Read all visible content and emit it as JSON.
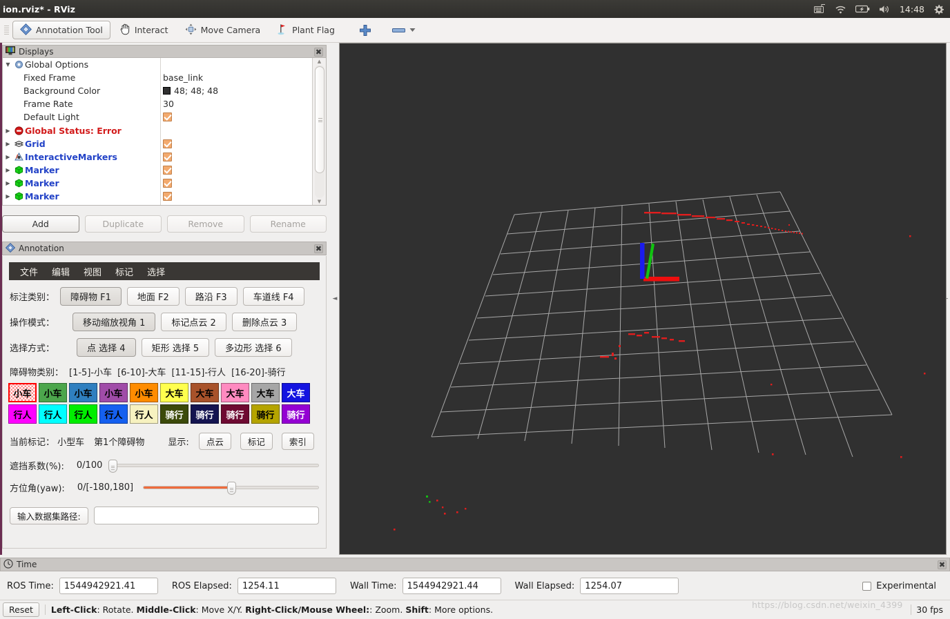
{
  "window": {
    "title": "ion.rviz* - RViz",
    "clock": "14:48",
    "tray_icons": [
      "keyboard-icon",
      "wifi-icon",
      "battery-icon",
      "volume-icon",
      "gear-icon"
    ]
  },
  "toolbar": {
    "items": [
      {
        "label": "Annotation Tool",
        "icon": "annotation-diamond-icon",
        "active": true
      },
      {
        "label": "Interact",
        "icon": "hand-cursor-icon",
        "active": false
      },
      {
        "label": "Move Camera",
        "icon": "move-camera-icon",
        "active": false
      },
      {
        "label": "Plant Flag",
        "icon": "flag-icon",
        "active": false
      }
    ],
    "add_tool_label": "+",
    "dropdown_label": ""
  },
  "displays": {
    "title": "Displays",
    "close_label": "✖",
    "rows": [
      {
        "name": "Global Options",
        "indent": false,
        "arrow": "▼",
        "icon": "gear-icon",
        "style": "plain",
        "value": "",
        "checkbox": false
      },
      {
        "name": "Fixed Frame",
        "indent": true,
        "arrow": "",
        "icon": "",
        "style": "plain",
        "value": "base_link",
        "checkbox": false
      },
      {
        "name": "Background Color",
        "indent": true,
        "arrow": "",
        "icon": "",
        "style": "plain",
        "value": "48; 48; 48",
        "swatch": "#303030",
        "checkbox": false
      },
      {
        "name": "Frame Rate",
        "indent": true,
        "arrow": "",
        "icon": "",
        "style": "plain",
        "value": "30",
        "checkbox": false
      },
      {
        "name": "Default Light",
        "indent": true,
        "arrow": "",
        "icon": "",
        "style": "plain",
        "value": "",
        "checkbox": true
      },
      {
        "name": "Global Status: Error",
        "indent": false,
        "arrow": "▶",
        "icon": "error-icon",
        "style": "red",
        "value": "",
        "checkbox": false
      },
      {
        "name": "Grid",
        "indent": false,
        "arrow": "▶",
        "icon": "grid-icon",
        "style": "blue",
        "value": "",
        "checkbox": true
      },
      {
        "name": "InteractiveMarkers",
        "indent": false,
        "arrow": "▶",
        "icon": "interactive-markers-icon",
        "style": "blue",
        "value": "",
        "checkbox": true
      },
      {
        "name": "Marker",
        "indent": false,
        "arrow": "▶",
        "icon": "marker-cube-icon",
        "style": "blue",
        "value": "",
        "checkbox": true
      },
      {
        "name": "Marker",
        "indent": false,
        "arrow": "▶",
        "icon": "marker-cube-icon",
        "style": "blue",
        "value": "",
        "checkbox": true
      },
      {
        "name": "Marker",
        "indent": false,
        "arrow": "▶",
        "icon": "marker-cube-icon",
        "style": "blue",
        "value": "",
        "checkbox": true
      }
    ],
    "buttons": [
      {
        "label": "Add",
        "enabled": true
      },
      {
        "label": "Duplicate",
        "enabled": false
      },
      {
        "label": "Remove",
        "enabled": false
      },
      {
        "label": "Rename",
        "enabled": false
      }
    ]
  },
  "annotation": {
    "title": "Annotation",
    "close_label": "✖",
    "menu": [
      "文件",
      "编辑",
      "视图",
      "标记",
      "选择"
    ],
    "label_type": "标注类别：",
    "type_buttons": [
      {
        "label": "障碍物 F1",
        "selected": true
      },
      {
        "label": "地面 F2",
        "selected": false
      },
      {
        "label": "路沿 F3",
        "selected": false
      },
      {
        "label": "车道线 F4",
        "selected": false
      }
    ],
    "label_mode": "操作模式：",
    "mode_buttons": [
      {
        "label": "移动缩放视角 1",
        "selected": true
      },
      {
        "label": "标记点云 2",
        "selected": false
      },
      {
        "label": "删除点云 3",
        "selected": false
      }
    ],
    "label_select": "选择方式：",
    "select_buttons": [
      {
        "label": "点 选择 4",
        "selected": true
      },
      {
        "label": "矩形 选择 5",
        "selected": false
      },
      {
        "label": "多边形 选择 6",
        "selected": false
      }
    ],
    "obstacle_legend_label": "障碍物类别：",
    "obstacle_legend": [
      "[1-5]-小车",
      "[6-10]-大车",
      "[11-15]-行人",
      "[16-20]-骑行"
    ],
    "cat_row1": [
      {
        "label": "小车",
        "bg": "#ff3b30",
        "fg": "#000000",
        "selected": true
      },
      {
        "label": "小车",
        "bg": "#4ca64c",
        "fg": "#000000",
        "selected": false
      },
      {
        "label": "小车",
        "bg": "#2f7fbf",
        "fg": "#000000",
        "selected": false
      },
      {
        "label": "小车",
        "bg": "#a04ca8",
        "fg": "#000000",
        "selected": false
      },
      {
        "label": "小车",
        "bg": "#ff8c00",
        "fg": "#000000",
        "selected": false
      },
      {
        "label": "大车",
        "bg": "#ffff4d",
        "fg": "#000000",
        "selected": false
      },
      {
        "label": "大车",
        "bg": "#a8522a",
        "fg": "#000000",
        "selected": false
      },
      {
        "label": "大车",
        "bg": "#ff8ac0",
        "fg": "#000000",
        "selected": false
      },
      {
        "label": "大车",
        "bg": "#a6a6a6",
        "fg": "#000000",
        "selected": false
      },
      {
        "label": "大车",
        "bg": "#1414e0",
        "fg": "#ffffff",
        "selected": false
      }
    ],
    "cat_row2": [
      {
        "label": "行人",
        "bg": "#ff00ff",
        "fg": "#000000",
        "selected": false
      },
      {
        "label": "行人",
        "bg": "#00ffff",
        "fg": "#000000",
        "selected": false
      },
      {
        "label": "行人",
        "bg": "#00ee00",
        "fg": "#000000",
        "selected": false
      },
      {
        "label": "行人",
        "bg": "#1560f0",
        "fg": "#000000",
        "selected": false
      },
      {
        "label": "行人",
        "bg": "#f7f2c0",
        "fg": "#000000",
        "selected": false
      },
      {
        "label": "骑行",
        "bg": "#3c4a0a",
        "fg": "#ffffff",
        "selected": false
      },
      {
        "label": "骑行",
        "bg": "#141450",
        "fg": "#ffffff",
        "selected": false
      },
      {
        "label": "骑行",
        "bg": "#6e0a32",
        "fg": "#ffffff",
        "selected": false
      },
      {
        "label": "骑行",
        "bg": "#b5a400",
        "fg": "#000000",
        "selected": false
      },
      {
        "label": "骑行",
        "bg": "#9400d3",
        "fg": "#ffffff",
        "selected": false
      }
    ],
    "current_label": "当前标记： 小型车",
    "current_index": "第1个障碍物",
    "display_label": "显示:",
    "display_buttons": [
      "点云",
      "标记",
      "索引"
    ],
    "occlusion_label": "遮挡系数(%):",
    "occlusion_value": "0/100",
    "occlusion_percent": 0,
    "yaw_label": "方位角(yaw):",
    "yaw_value": "0/[-180,180]",
    "yaw_percent": 50,
    "path_button": "输入数据集路径:",
    "path_value": "",
    "path_placeholder": ""
  },
  "time": {
    "title": "Time",
    "close_label": "✖",
    "fields": [
      {
        "label": "ROS Time:",
        "value": "1544942921.41"
      },
      {
        "label": "ROS Elapsed:",
        "value": "1254.11"
      },
      {
        "label": "Wall Time:",
        "value": "1544942921.44"
      },
      {
        "label": "Wall Elapsed:",
        "value": "1254.07"
      }
    ],
    "experimental_label": "Experimental",
    "experimental_checked": false
  },
  "status": {
    "reset_label": "Reset",
    "hint_parts": [
      {
        "text": "Left-Click",
        "bold": true
      },
      {
        "text": ": Rotate. ",
        "bold": false
      },
      {
        "text": "Middle-Click",
        "bold": true
      },
      {
        "text": ": Move X/Y. ",
        "bold": false
      },
      {
        "text": "Right-Click/Mouse Wheel:",
        "bold": true
      },
      {
        "text": ": Zoom. ",
        "bold": false
      },
      {
        "text": "Shift",
        "bold": true
      },
      {
        "text": ": More options.",
        "bold": false
      }
    ],
    "fps": "30 fps",
    "watermark": "https://blog.csdn.net/weixin_4399"
  },
  "viewport": {
    "background": "#303030",
    "grid_color": "#bdbdbd",
    "axis_colors": {
      "x": "#ff0000",
      "y": "#00cc00",
      "z": "#2222ee"
    }
  }
}
